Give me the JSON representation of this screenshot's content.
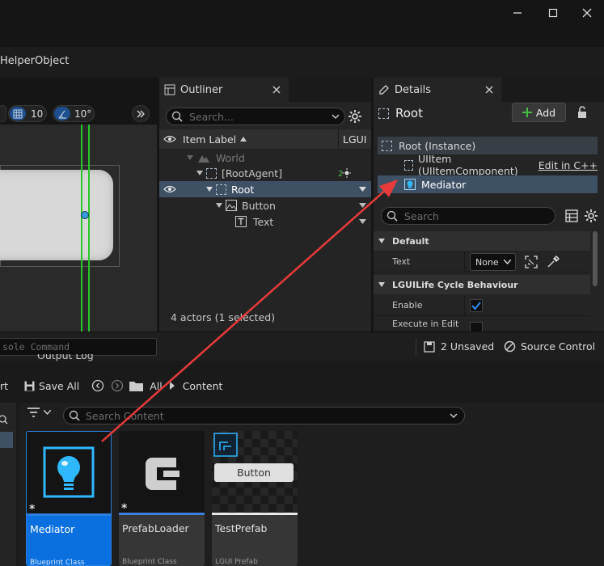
{
  "window": {
    "title": "HelperObject"
  },
  "viewport": {
    "grid_value": "10",
    "angle_value": "10°"
  },
  "outliner": {
    "tab_label": "Outliner",
    "search_placeholder": "Search...",
    "col_item_label": "Item Label",
    "col_lgui": "LGUI",
    "rows": [
      "World",
      "[RootAgent]",
      "Root",
      "Button",
      "Text"
    ],
    "footer": "4 actors (1 selected)"
  },
  "details": {
    "tab_label": "Details",
    "object_name": "Root",
    "add_label": "Add",
    "components": {
      "instance": "Root (Instance)",
      "uiitem": "UIItem (UIItemComponent)",
      "edit_link": "Edit in C++",
      "mediator": "Mediator"
    },
    "search_placeholder": "Search",
    "cat_default": "Default",
    "prop_text": "Text",
    "prop_text_value": "None",
    "cat_lifecycle": "LGUILife Cycle Behaviour",
    "prop_enable": "Enable",
    "prop_execute": "Execute in Edit"
  },
  "console": {
    "placeholder": "sole Command",
    "unsaved": "2 Unsaved",
    "source_control": "Source Control"
  },
  "content_browser": {
    "output_log_tab": "Output Log",
    "import_partial": "rt",
    "save_all": "Save All",
    "path": [
      "All",
      "Content"
    ],
    "search_placeholder": "Search Content",
    "assets": [
      {
        "name": "Mediator",
        "type": "Blueprint Class"
      },
      {
        "name": "PrefabLoader",
        "type": "Blueprint Class"
      },
      {
        "name": "TestPrefab",
        "type": "LGUI Prefab",
        "preview_button": "Button"
      }
    ]
  },
  "colors": {
    "accent": "#0070e0",
    "selection": "#3e5064",
    "arrow": "#e83a3a"
  },
  "icons": [
    "minimize-icon",
    "maximize-icon",
    "close-icon",
    "grid-icon",
    "angle-icon",
    "eye-icon",
    "gear-icon",
    "lightbulb-icon",
    "lock-icon",
    "save-icon",
    "folder-icon",
    "filter-icon"
  ]
}
